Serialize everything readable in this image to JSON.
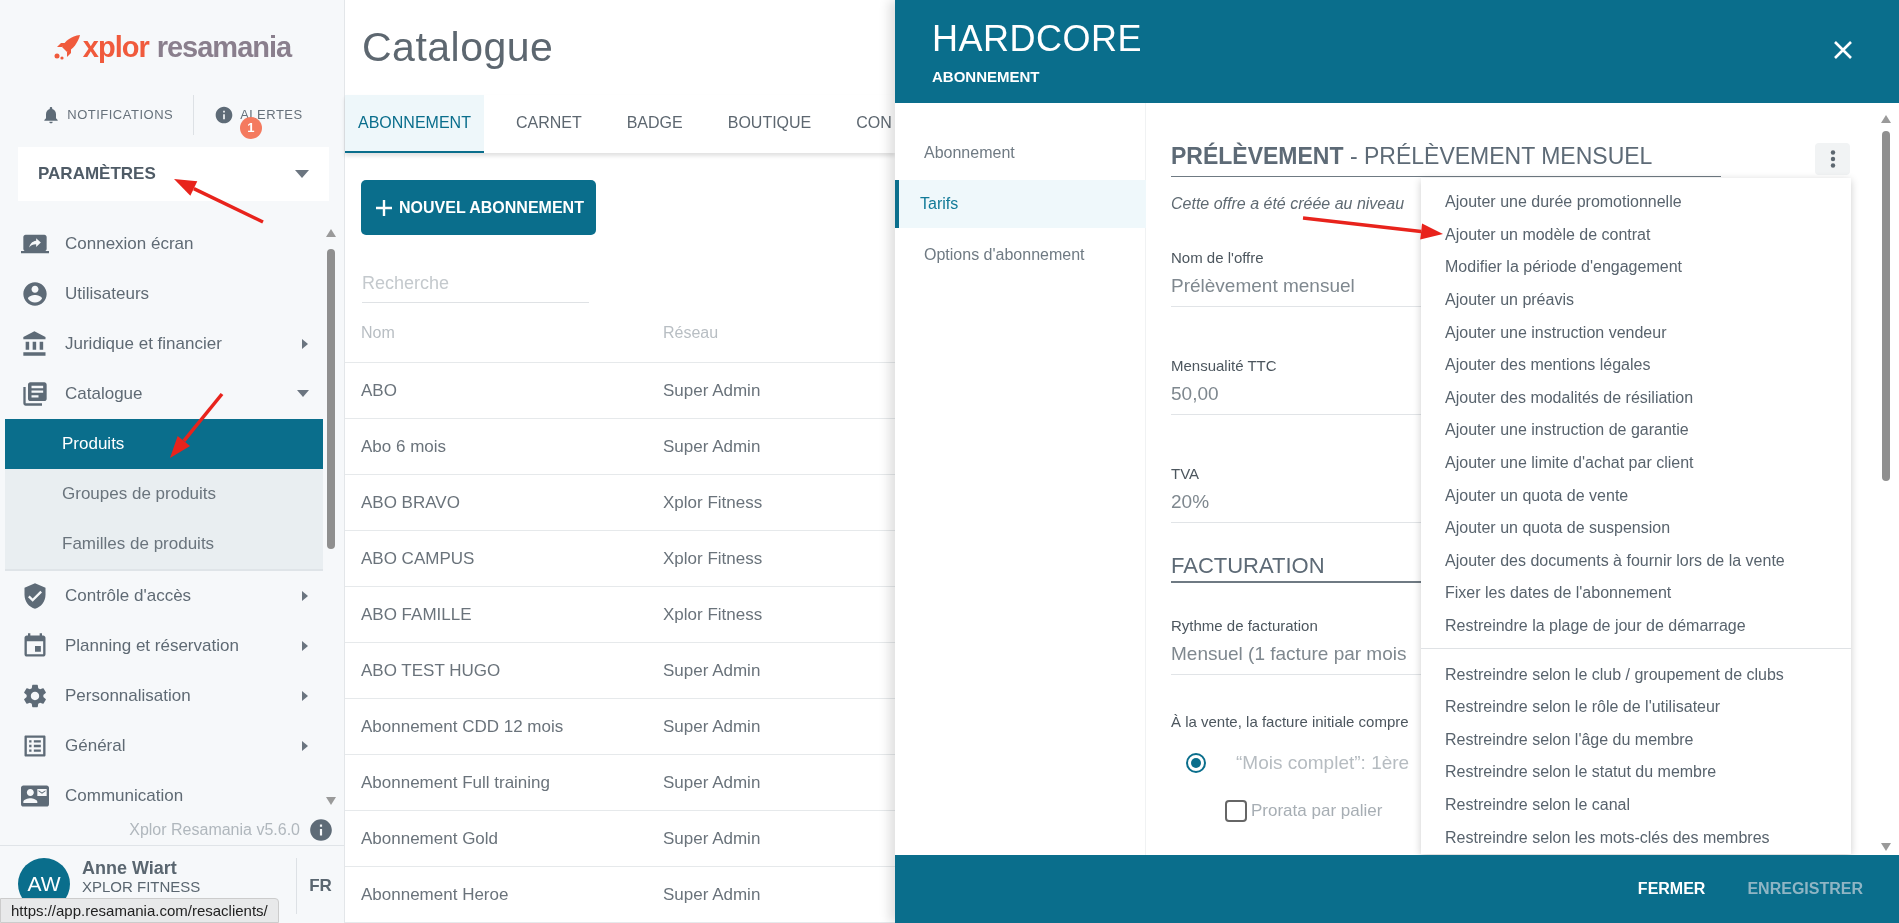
{
  "sidebar": {
    "logo": {
      "brand": "xplor",
      "product": "resamania"
    },
    "top_links": [
      {
        "label": "NOTIFICATIONS"
      },
      {
        "label": "ALERTES",
        "badge": "1"
      }
    ],
    "section_select": {
      "value": "PARAMÈTRES"
    },
    "menu": [
      {
        "label": "Connexion écran",
        "kind": "link"
      },
      {
        "label": "Utilisateurs",
        "kind": "link"
      },
      {
        "label": "Juridique et financier",
        "kind": "group",
        "expanded": false
      },
      {
        "label": "Catalogue",
        "kind": "group",
        "expanded": true,
        "children": [
          {
            "label": "Produits",
            "selected": true
          },
          {
            "label": "Groupes de produits",
            "selected": false
          },
          {
            "label": "Familles de produits",
            "selected": false
          }
        ]
      },
      {
        "label": "Contrôle d'accès",
        "kind": "group",
        "expanded": false
      },
      {
        "label": "Planning et réservation",
        "kind": "group",
        "expanded": false
      },
      {
        "label": "Personnalisation",
        "kind": "group",
        "expanded": false
      },
      {
        "label": "Général",
        "kind": "group",
        "expanded": false
      },
      {
        "label": "Communication",
        "kind": "link"
      }
    ],
    "version": "Xplor Resamania v5.6.0",
    "user": {
      "initials": "AW",
      "name": "Anne Wiart",
      "organization": "XPLOR FITNESS"
    },
    "language": "FR"
  },
  "link_preview": "https://app.resamania.com/resaclients/",
  "page": {
    "title": "Catalogue",
    "tabs": [
      {
        "label": "ABONNEMENT",
        "selected": true
      },
      {
        "label": "CARNET",
        "selected": false
      },
      {
        "label": "BADGE",
        "selected": false
      },
      {
        "label": "BOUTIQUE",
        "selected": false
      },
      {
        "label": "CON",
        "selected": false
      }
    ],
    "new_button": "NOUVEL ABONNEMENT",
    "search": {
      "placeholder": "Recherche"
    },
    "table": {
      "columns": [
        "Nom",
        "Réseau"
      ],
      "rows": [
        [
          "ABO",
          "Super Admin"
        ],
        [
          "Abo 6 mois",
          "Super Admin"
        ],
        [
          "ABO BRAVO",
          "Xplor Fitness"
        ],
        [
          "ABO CAMPUS",
          "Xplor Fitness"
        ],
        [
          "ABO FAMILLE",
          "Xplor Fitness"
        ],
        [
          "ABO TEST HUGO",
          "Super Admin"
        ],
        [
          "Abonnement CDD 12 mois",
          "Super Admin"
        ],
        [
          "Abonnement Full training",
          "Super Admin"
        ],
        [
          "Abonnement Gold",
          "Super Admin"
        ],
        [
          "Abonnement Heroe",
          "Super Admin"
        ]
      ]
    }
  },
  "panel": {
    "title": "HARDCORE",
    "subtitle": "ABONNEMENT",
    "nav": [
      {
        "label": "Abonnement",
        "selected": false
      },
      {
        "label": "Tarifs",
        "selected": true
      },
      {
        "label": "Options d'abonnement",
        "selected": false
      }
    ],
    "section_title": "**PRÉLÈVEMENT** - PRÉLÈVEMENT MENSUEL",
    "note": "Cette offre a été créée au niveau",
    "fields": [
      {
        "label": "Nom de l'offre",
        "value": "Prélèvement mensuel"
      },
      {
        "label": "Mensualité TTC",
        "value": "50,00"
      },
      {
        "label": "TVA",
        "value": "20%"
      }
    ],
    "billing_heading": "FACTURATION",
    "billing_field": {
      "label": "Rythme de facturation",
      "value": "Mensuel (1 facture par mois"
    },
    "initial_invoice_note": "À la vente, la facture initiale compre",
    "radio": {
      "label": "“Mois complet”: 1ère",
      "selected": true
    },
    "checkbox": {
      "label": "Prorata par palier",
      "checked": false
    },
    "menu_groups": [
      [
        "Ajouter une durée promotionnelle",
        "Ajouter un modèle de contrat",
        "Modifier la période d'engagement",
        "Ajouter un préavis",
        "Ajouter une instruction vendeur",
        "Ajouter des mentions légales",
        "Ajouter des modalités de résiliation",
        "Ajouter une instruction de garantie",
        "Ajouter une limite d'achat par client",
        "Ajouter un quota de vente",
        "Ajouter un quota de suspension",
        "Ajouter des documents à fournir lors de la vente",
        "Fixer les dates de l'abonnement",
        "Restreindre la plage de jour de démarrage"
      ],
      [
        "Restreindre selon le club / groupement de clubs",
        "Restreindre selon le rôle de l'utilisateur",
        "Restreindre selon l'âge du membre",
        "Restreindre selon le statut du membre",
        "Restreindre selon le canal",
        "Restreindre selon les mots-clés des membres"
      ]
    ],
    "footer_buttons": [
      {
        "label": "FERMER",
        "disabled": false
      },
      {
        "label": "ENREGISTRER",
        "disabled": true
      }
    ]
  }
}
